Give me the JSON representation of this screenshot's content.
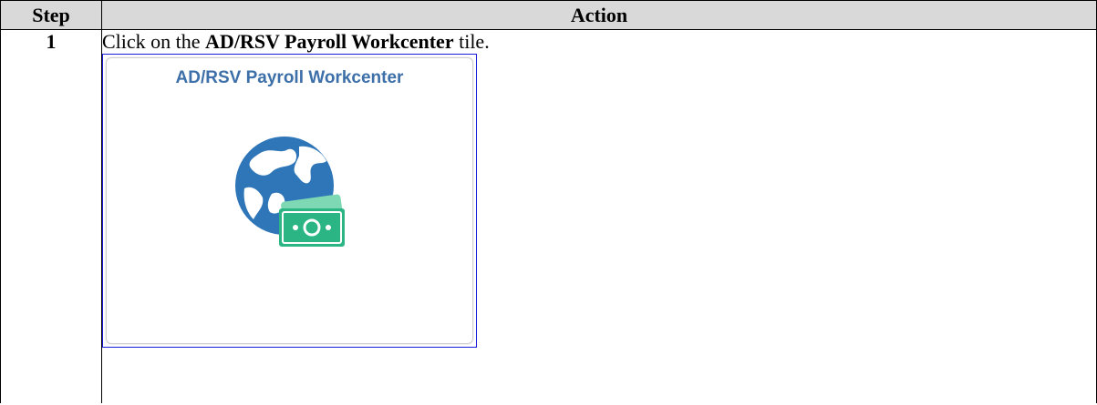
{
  "table": {
    "header_step": "Step",
    "header_action": "Action"
  },
  "rows": [
    {
      "step": "1",
      "instruction_prefix": "Click on the ",
      "instruction_bold": "AD/RSV Payroll Workcenter",
      "instruction_suffix": " tile.",
      "tile": {
        "title": "AD/RSV Payroll Workcenter",
        "icon": "globe-money-icon"
      }
    }
  ],
  "colors": {
    "tile_title": "#3d6fa8",
    "globe": "#2e76b8",
    "money": "#2bb585",
    "highlight_border": "#1a1adb"
  }
}
